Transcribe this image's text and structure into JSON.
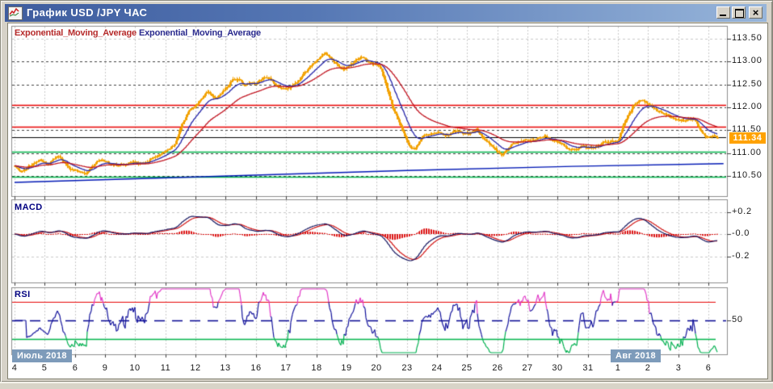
{
  "window": {
    "title": "График USD /JPY  ЧАС",
    "controls": [
      {
        "name": "minimize"
      },
      {
        "name": "maximize"
      },
      {
        "name": "close"
      }
    ]
  },
  "legend": {
    "ema1": {
      "label": "Exponential_Moving_Average",
      "color": "#b62b2b"
    },
    "ema2": {
      "label": "Exponential_Moving_Average",
      "color": "#2b2b8e"
    }
  },
  "price_axis": {
    "labels": [
      "113.50",
      "113.00",
      "112.50",
      "112.00",
      "111.50",
      "111.00",
      "110.50"
    ],
    "values": [
      113.5,
      113.0,
      112.5,
      112.0,
      111.5,
      111.0,
      110.5
    ],
    "current_price": "111.34",
    "current_badge_color": "#ffa200"
  },
  "macd_panel": {
    "title": "MACD",
    "axis_labels": [
      "+0.2",
      "-0.0",
      "-0.2"
    ],
    "axis_values": [
      0.2,
      0.0,
      -0.2
    ]
  },
  "rsi_panel": {
    "title": "RSI",
    "axis_labels": [
      "50"
    ],
    "axis_values": [
      50
    ]
  },
  "x_axis": {
    "labels": [
      "4",
      "5",
      "6",
      "9",
      "10",
      "11",
      "12",
      "13",
      "16",
      "17",
      "18",
      "19",
      "20",
      "23",
      "24",
      "25",
      "26",
      "27",
      "30",
      "31",
      "1",
      "2",
      "3",
      "6"
    ],
    "month_badges": [
      {
        "label": "Июль 2018"
      },
      {
        "label": "Авг 2018"
      }
    ]
  },
  "chart_data": {
    "type": "candlestick",
    "symbol": "USD/JPY",
    "timeframe_label": "ЧАС",
    "ylim_main": [
      110.06,
      113.78
    ],
    "ylim_macd": [
      -0.44,
      0.31
    ],
    "ylim_rsi": [
      13.5,
      85.6
    ],
    "price_levels": {
      "resistance": [
        112.06,
        111.57
      ],
      "support": [
        111.03,
        110.49
      ],
      "last_price": 111.34
    },
    "trend_line_price": [
      [
        0,
        110.36
      ],
      [
        6,
        110.48
      ],
      [
        13,
        110.62
      ],
      [
        18.5,
        110.71
      ],
      [
        23.5,
        110.77
      ]
    ],
    "rsi_bands": {
      "overbought": 70,
      "mid": 50,
      "oversold": 30
    },
    "price_waypoints": [
      [
        0.0,
        110.72
      ],
      [
        0.2,
        110.62
      ],
      [
        0.5,
        110.78
      ],
      [
        0.8,
        110.83
      ],
      [
        1.1,
        110.8
      ],
      [
        1.45,
        110.94
      ],
      [
        1.8,
        110.7
      ],
      [
        2.1,
        110.62
      ],
      [
        2.35,
        110.53
      ],
      [
        2.7,
        110.78
      ],
      [
        3.0,
        110.86
      ],
      [
        3.4,
        110.7
      ],
      [
        3.8,
        110.75
      ],
      [
        4.2,
        110.82
      ],
      [
        4.6,
        110.92
      ],
      [
        5.0,
        111.02
      ],
      [
        5.3,
        111.18
      ],
      [
        5.55,
        111.65
      ],
      [
        5.8,
        111.98
      ],
      [
        6.1,
        112.12
      ],
      [
        6.4,
        112.28
      ],
      [
        6.7,
        112.18
      ],
      [
        7.0,
        112.42
      ],
      [
        7.25,
        112.62
      ],
      [
        7.6,
        112.48
      ],
      [
        8.0,
        112.56
      ],
      [
        8.3,
        112.66
      ],
      [
        8.65,
        112.48
      ],
      [
        9.0,
        112.42
      ],
      [
        9.35,
        112.55
      ],
      [
        9.7,
        112.8
      ],
      [
        10.0,
        112.96
      ],
      [
        10.3,
        113.1
      ],
      [
        10.6,
        112.94
      ],
      [
        10.9,
        112.86
      ],
      [
        11.2,
        113.02
      ],
      [
        11.5,
        113.12
      ],
      [
        11.8,
        112.98
      ],
      [
        12.1,
        112.9
      ],
      [
        12.3,
        112.45
      ],
      [
        12.55,
        111.95
      ],
      [
        12.8,
        111.6
      ],
      [
        13.05,
        111.18
      ],
      [
        13.25,
        111.08
      ],
      [
        13.5,
        111.38
      ],
      [
        13.8,
        111.44
      ],
      [
        14.2,
        111.38
      ],
      [
        14.6,
        111.48
      ],
      [
        15.0,
        111.42
      ],
      [
        15.3,
        111.52
      ],
      [
        15.6,
        111.32
      ],
      [
        15.9,
        111.12
      ],
      [
        16.15,
        110.97
      ],
      [
        16.5,
        111.15
      ],
      [
        16.8,
        111.22
      ],
      [
        17.2,
        111.28
      ],
      [
        17.6,
        111.35
      ],
      [
        18.0,
        111.24
      ],
      [
        18.4,
        111.08
      ],
      [
        18.8,
        111.15
      ],
      [
        19.2,
        111.12
      ],
      [
        19.6,
        111.22
      ],
      [
        20.0,
        111.35
      ],
      [
        20.25,
        111.72
      ],
      [
        20.5,
        112.02
      ],
      [
        20.75,
        112.15
      ],
      [
        21.0,
        112.02
      ],
      [
        21.3,
        111.88
      ],
      [
        21.7,
        111.78
      ],
      [
        22.1,
        111.72
      ],
      [
        22.5,
        111.74
      ],
      [
        22.75,
        111.45
      ],
      [
        22.95,
        111.3
      ],
      [
        23.15,
        111.4
      ],
      [
        23.35,
        111.34
      ]
    ],
    "colors": {
      "candle": "#f2a100",
      "ema_fast": "#2424a8",
      "ema_slow": "#c01420",
      "macd_line": "#14145e",
      "macd_signal": "#d01414",
      "macd_hist": "#dc1414",
      "rsi_line": "#14149c",
      "rsi_overbought": "#e23cc8",
      "rsi_oversold": "#00b050",
      "resistance": "#e60000",
      "support": "#00b44a",
      "last_price_line": "#000000",
      "trend": "#0018b4",
      "grid": "#c9c9c9",
      "panel_border": "#8c8c8c"
    }
  }
}
